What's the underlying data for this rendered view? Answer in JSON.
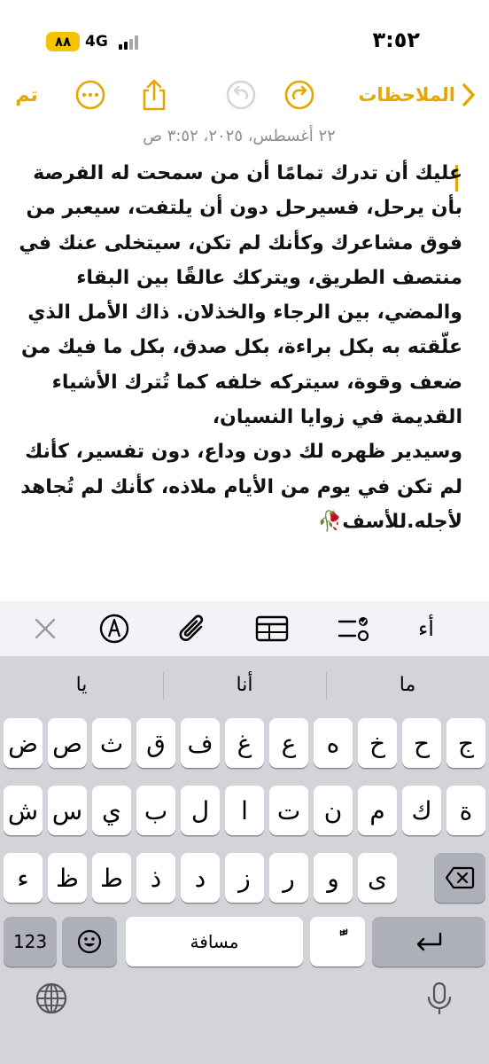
{
  "status_bar": {
    "time": "٣:٥٢",
    "battery": "٨٨",
    "network": "4G"
  },
  "toolbar": {
    "done_label": "تم",
    "back_label": "الملاحظات",
    "accent_color": "#e3a700"
  },
  "note": {
    "date": "٢٢ أغسطس، ٢٠٢٥، ٣:٥٢ ص",
    "body": "عليك أن تدرك تمامًا أن من سمحت له الفرصة بأن يرحل، فسيرحل دون أن يلتفت، سيعبر من فوق مشاعرك وكأنك لم تكن، سيتخلى عنك في منتصف الطريق، ويتركك عالقًا بين البقاء والمضي، بين الرجاء والخذلان. ذاك الأمل الذي علّقته به بكل براءة، بكل صدق، بكل ما فيك من ضعف وقوة، سيتركه خلفه كما تُترك الأشياء القديمة في زوايا النسيان،\nوسيدير ظهره لك دون وداع، دون تفسير، كأنك لم تكن في يوم من الأيام ملاذه، كأنك لم تُجاهد لأجله.للأسف🥀"
  },
  "format_bar": {
    "text_style_label": "أء",
    "icons": [
      "checklist-icon",
      "table-icon",
      "attachment-icon",
      "markup-icon",
      "close-icon"
    ]
  },
  "keyboard": {
    "suggestions": [
      "ما",
      "أنا",
      "يا"
    ],
    "row1": [
      "ج",
      "ح",
      "خ",
      "ه",
      "ع",
      "غ",
      "ف",
      "ق",
      "ث",
      "ص",
      "ض"
    ],
    "row2": [
      "ة",
      "ك",
      "م",
      "ن",
      "ت",
      "ا",
      "ل",
      "ب",
      "ي",
      "س",
      "ش"
    ],
    "row3": [
      "ى",
      "و",
      "ر",
      "ز",
      "د",
      "ذ",
      "ط",
      "ظ",
      "ء"
    ],
    "numbers_label": "123",
    "space_label": "مسافة",
    "diacritic_label": "ًّ"
  }
}
